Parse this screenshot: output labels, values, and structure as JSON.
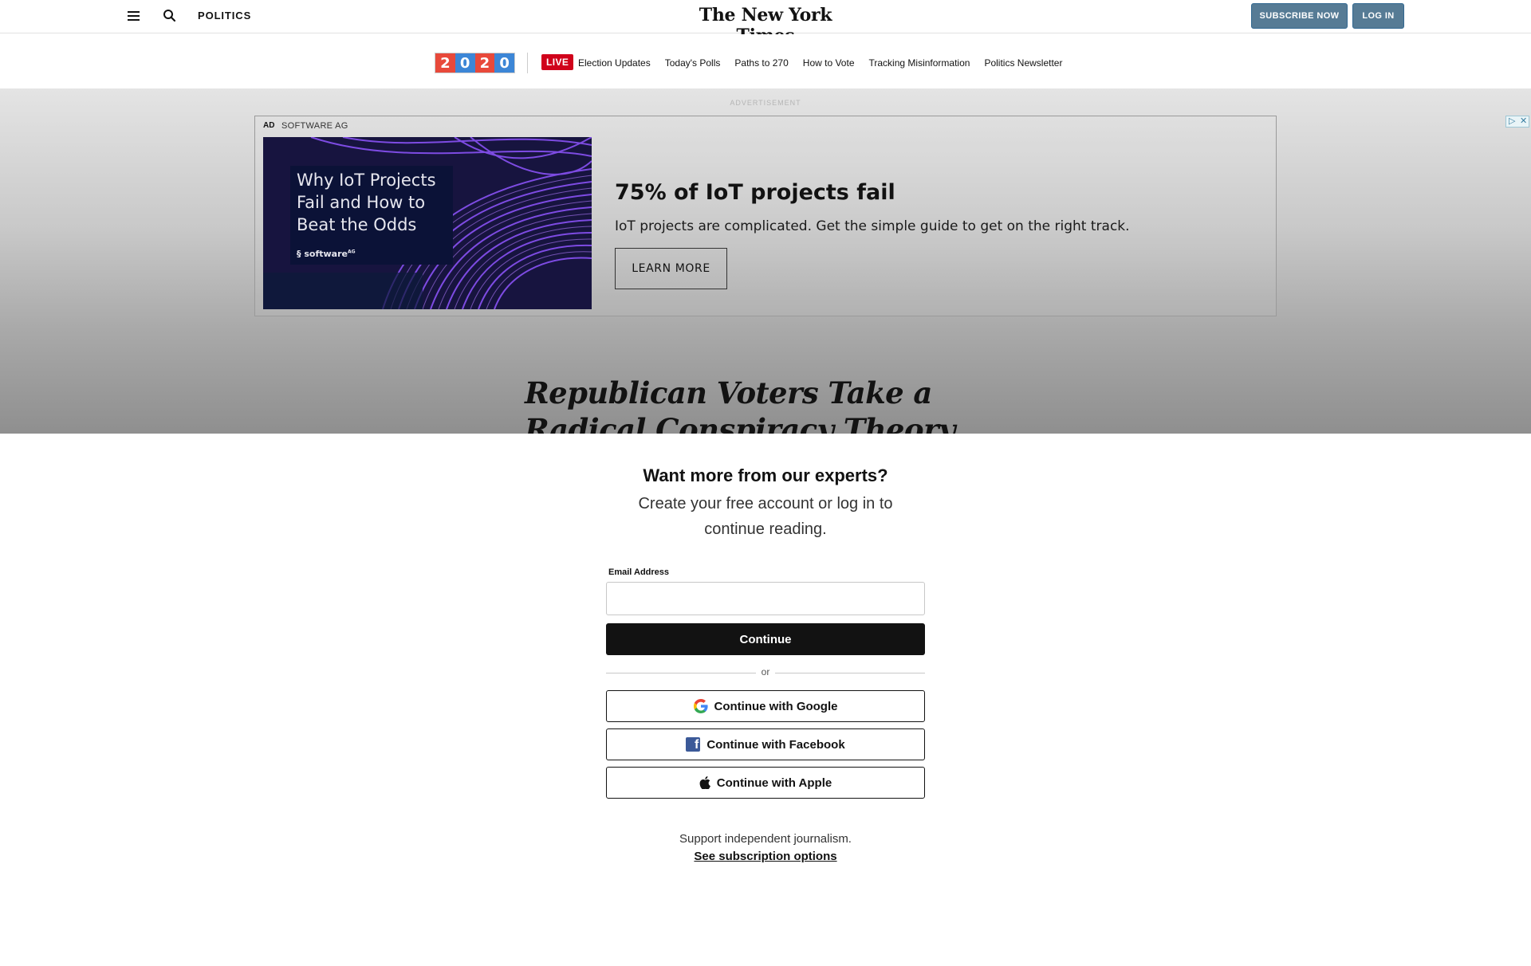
{
  "header": {
    "section": "POLITICS",
    "logo_text": "The New York Times",
    "subscribe_label": "SUBSCRIBE NOW",
    "login_label": "LOG IN",
    "icons": {
      "menu": "hamburger-menu-icon",
      "search": "search-icon"
    }
  },
  "election_nav": {
    "year_digits": [
      "2",
      "0",
      "2",
      "0"
    ],
    "year_colors": [
      "#e8493a",
      "#3c86d6",
      "#e8493a",
      "#3c86d6"
    ],
    "live_label": "LIVE",
    "links": [
      "Election Updates",
      "Today's Polls",
      "Paths to 270",
      "How to Vote",
      "Tracking Misinformation",
      "Politics Newsletter"
    ]
  },
  "ad": {
    "label": "ADVERTISEMENT",
    "tag": "AD",
    "sponsor": "SOFTWARE AG",
    "image_title": "Why IoT Projects Fail and How to Beat the Odds",
    "image_brand": "software",
    "headline": "75% of IoT projects fail",
    "body": "IoT projects are complicated. Get the simple guide to get on the right track.",
    "cta": "LEARN MORE"
  },
  "article": {
    "headline": "Republican Voters Take a Radical Conspiracy Theory Mainstream"
  },
  "modal": {
    "title": "Want more from our experts?",
    "subtitle": "Create your free account or log in to continue reading.",
    "email_label": "Email Address",
    "email_value": "",
    "continue_label": "Continue",
    "or_label": "or",
    "google_label": "Continue with Google",
    "facebook_label": "Continue with Facebook",
    "apple_label": "Continue with Apple",
    "support_text": "Support independent journalism.",
    "subscription_link": "See subscription options"
  },
  "colors": {
    "subscribe_bg": "#567b95",
    "live_red": "#d0021b",
    "facebook_blue": "#3b5998",
    "ad_purple": "#7b3fe0"
  }
}
